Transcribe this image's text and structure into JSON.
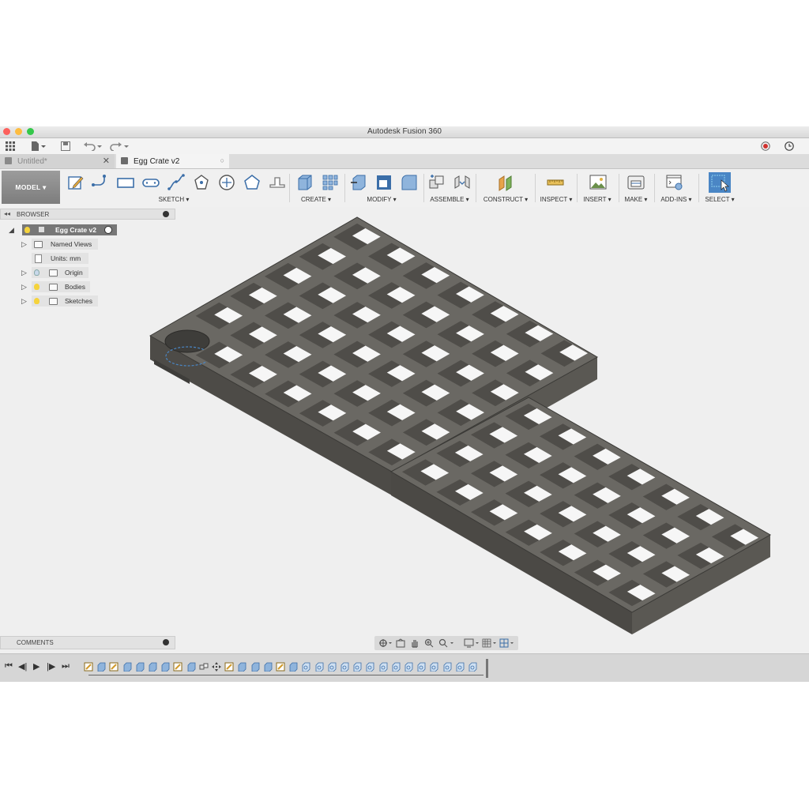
{
  "window": {
    "title": "Autodesk Fusion 360"
  },
  "tabs": [
    {
      "label": "Untitled*",
      "active": false
    },
    {
      "label": "Egg Crate v2",
      "active": true
    }
  ],
  "toolbar": {
    "workspace": "MODEL ▾",
    "groups": [
      "SKETCH ▾",
      "CREATE ▾",
      "MODIFY ▾",
      "ASSEMBLE ▾",
      "CONSTRUCT ▾",
      "INSPECT ▾",
      "INSERT ▾",
      "MAKE ▾",
      "ADD-INS ▾",
      "SELECT ▾"
    ]
  },
  "browser": {
    "title": "BROWSER",
    "root": "Egg Crate v2",
    "items": [
      "Named Views",
      "Units: mm",
      "Origin",
      "Bodies",
      "Sketches"
    ]
  },
  "comments": {
    "title": "COMMENTS"
  },
  "colors": {
    "accent": "#0696d7",
    "model_body": "#5f5d58",
    "select_blue": "#4a86c5"
  },
  "icons": [
    "grid-menu-icon",
    "file-icon",
    "save-icon",
    "undo-icon",
    "redo-icon",
    "record-icon",
    "clock-icon",
    "play-icon"
  ]
}
